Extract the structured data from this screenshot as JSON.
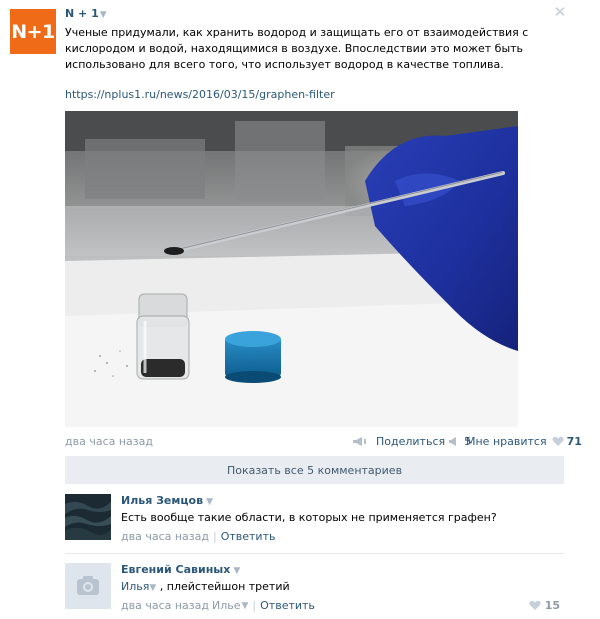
{
  "post": {
    "author": "N + 1",
    "avatar_text": "N+1",
    "text": "Ученые придумали, как хранить водород и защищать его от взаимодействия с кислородом и водой, находящимися в воздухе. Впоследствии это может быть использовано для всего того, что использует водород в качестве топлива.",
    "link": "https://nplus1.ru/news/2016/03/15/graphen-filter",
    "time": "два часа назад",
    "share_label": "Поделиться",
    "share_count": "5",
    "like_label": "Мне нравится",
    "like_count": "71",
    "show_all_comments": "Показать все 5 комментариев"
  },
  "comments": [
    {
      "author": "Илья Земцов",
      "text": "Есть вообще такие области, в которых не применяется графен?",
      "time": "два часа назад",
      "reply": "Ответить"
    },
    {
      "author": "Евгений Савиных",
      "mention": "Илья",
      "text": ", плейстейшон третий",
      "time": "два часа назад",
      "meta_mention": "Илье",
      "reply": "Ответить",
      "like_count": "15"
    }
  ],
  "colors": {
    "brand_orange": "#ef6b17",
    "link_blue": "#2b587a",
    "meta_gray": "#8c9aa9",
    "bar_bg": "#e9edf1"
  },
  "icons": [
    "close-icon",
    "megaphone-icon",
    "heart-icon",
    "camera-icon"
  ]
}
